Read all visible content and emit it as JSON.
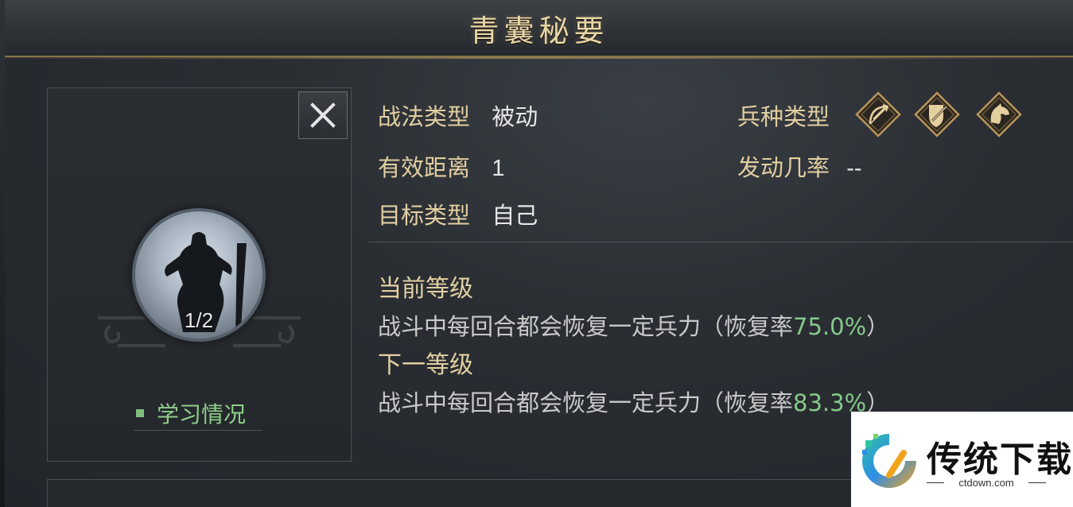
{
  "title": "青囊秘要",
  "card": {
    "level": "1/2",
    "study_label": "学习情况"
  },
  "info": {
    "tactic_type_label": "战法类型",
    "tactic_type_value": "被动",
    "range_label": "有效距离",
    "range_value": "1",
    "target_label": "目标类型",
    "target_value": "自己",
    "troop_label": "兵种类型",
    "troop_icons": [
      "bow-icon",
      "shield-icon",
      "horse-icon"
    ],
    "trigger_label": "发动几率",
    "trigger_value": "--"
  },
  "levels": {
    "current_title": "当前等级",
    "current_desc": "战斗中每回合都会恢复一定兵力（恢复率",
    "current_rate": "75.0%",
    "current_close": "）",
    "next_title": "下一等级",
    "next_desc": "战斗中每回合都会恢复一定兵力（恢复率",
    "next_rate": "83.3%",
    "next_close": "）"
  },
  "watermark": {
    "title": "传统下载",
    "sub": "ctdown.com"
  },
  "colors": {
    "gold": "#e2cfa1",
    "green": "#86c98a"
  }
}
